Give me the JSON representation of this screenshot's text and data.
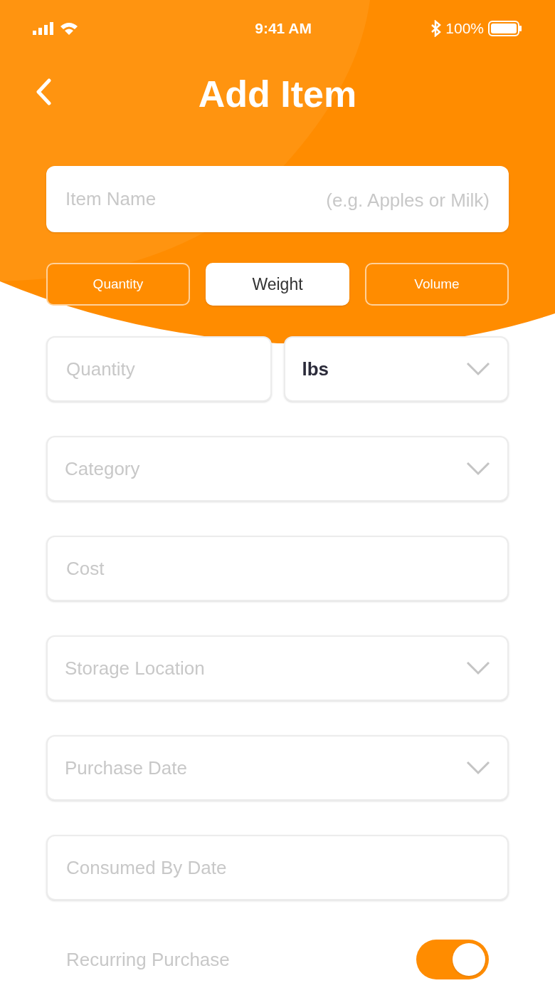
{
  "status_bar": {
    "time": "9:41 AM",
    "battery": "100%"
  },
  "header": {
    "title": "Add Item"
  },
  "item_name": {
    "placeholder": "Item Name",
    "hint": "(e.g. Apples or Milk)"
  },
  "unit_tabs": [
    {
      "label": "Quantity",
      "selected": false
    },
    {
      "label": "Weight",
      "selected": true
    },
    {
      "label": "Volume",
      "selected": false
    }
  ],
  "amount_row": [
    {
      "kind": "text",
      "placeholder": "Quantity"
    },
    {
      "kind": "select",
      "value": "lbs"
    }
  ],
  "fields": [
    {
      "kind": "select",
      "placeholder": "Category"
    },
    {
      "kind": "text",
      "placeholder": "Cost"
    },
    {
      "kind": "select",
      "placeholder": "Storage Location"
    },
    {
      "kind": "select",
      "placeholder": "Purchase Date"
    },
    {
      "kind": "text",
      "placeholder": "Consumed By Date"
    }
  ],
  "recurring": {
    "label": "Recurring Purchase",
    "on": true
  }
}
